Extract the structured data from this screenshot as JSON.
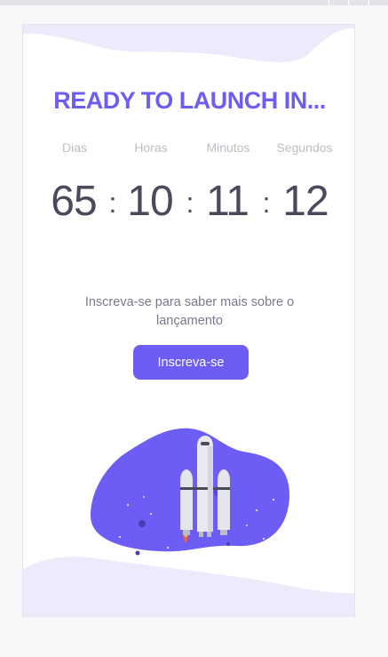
{
  "headline": "READY TO LAUNCH IN...",
  "countdown": {
    "labels": {
      "days": "Dias",
      "hours": "Horas",
      "minutes": "Minutos",
      "seconds": "Segundos"
    },
    "values": {
      "days": "65",
      "hours": "10",
      "minutes": "11",
      "seconds": "12"
    },
    "separator": ":"
  },
  "subtitle": "Inscreva-se para saber mais sobre o lançamento",
  "subscribe_button": "Inscreva-se",
  "colors": {
    "accent": "#6c5ef5",
    "text_dark": "#4a4a5c",
    "label_gray": "#bdbdc6",
    "wave_light": "#edebfb",
    "page_bg": "#f7f7f9"
  },
  "icons": {
    "illustration": "rocket-launch-illustration"
  }
}
